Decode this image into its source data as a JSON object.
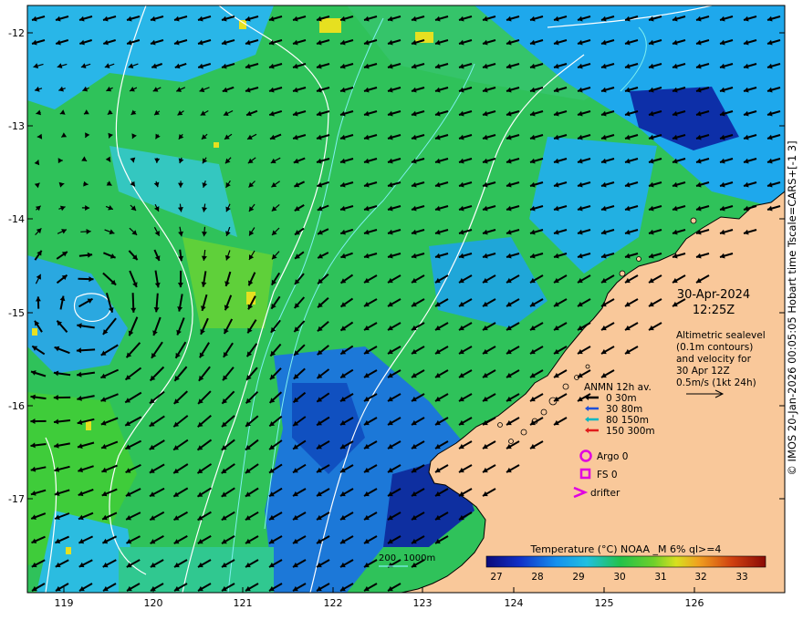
{
  "map": {
    "lon_ticks": [
      "119",
      "120",
      "121",
      "122",
      "123",
      "124",
      "125",
      "126"
    ],
    "lat_ticks": [
      "-12",
      "-13",
      "-14",
      "-15",
      "-16",
      "-17"
    ]
  },
  "timestamp": {
    "date": "30-Apr-2024",
    "time": "12:25Z"
  },
  "info": {
    "line1": "Altimetric sealevel",
    "line2": "(0.1m contours)",
    "line3": "and velocity for",
    "line4": "30 Apr 12Z",
    "line5": "0.5m/s (1kt 24h)"
  },
  "legend": {
    "title": "ANMN 12h av.",
    "items": [
      {
        "label": "0 30m",
        "color": "#000000"
      },
      {
        "label": "30 80m",
        "color": "#1f4fd8"
      },
      {
        "label": "80 150m",
        "color": "#00b7c3"
      },
      {
        "label": "150 300m",
        "color": "#e01b1b"
      }
    ],
    "argo": "Argo 0",
    "fs": "FS 0",
    "drifter": "drifter",
    "marker_color": "#e000e0"
  },
  "bathymetry": {
    "label_200": "200",
    "label_1000": "1000m"
  },
  "colorbar": {
    "title": "Temperature (°C) NOAA _M 6% ql>=4",
    "ticks": [
      "27",
      "28",
      "29",
      "30",
      "31",
      "32",
      "33"
    ]
  },
  "side_caption": "© IMOS 20-Jan-2026 00:05:05 Hobart time Tscale=CARS+[-1 3]"
}
